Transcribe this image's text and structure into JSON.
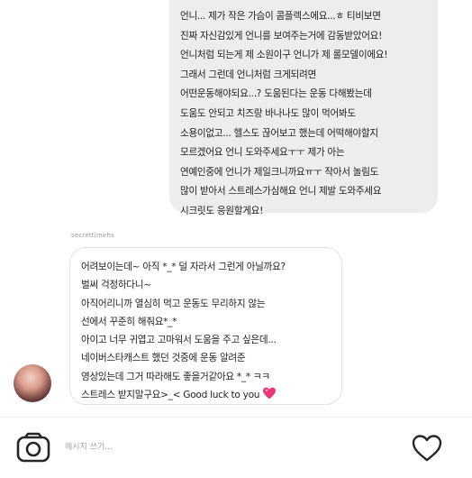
{
  "outgoing_message": {
    "lines": [
      "언니... 제가 작은 가슴이 콤플렉스에요...ㅎ 티비보면",
      "진짜 자신감있게 언니를 보여주는거에 감동받았어요!",
      "언니처럼 되는게 제 소원이구 언니가 제 롤모델이에요!",
      "그래서 그런데 언니처럼 크게되려면",
      "어떤운동해야되요...? 도움된다는 운동 다해봤는데",
      "도움도 안되고 치즈랑 바나나도 많이 먹어봐도",
      "소용이없고... 헬스도 끊어보고 했는데 어떡해야할지",
      "모르겠어요 언니 도와주세요ㅜㅜ 제가 아는",
      "연예인중에 언니가 제일크니까요ㅠㅜ 작아서 놀림도",
      "많이 받아서 스트레스가심해요 언니 제발 도와주세요",
      "시크릿도 응원할게요!"
    ]
  },
  "sender_name": "secrettimehs",
  "incoming_message": {
    "lines": [
      "어려보이는데~ 아직 *_* 덜 자라서 그런게 아닐까요?",
      "벌써 걱정하다니~",
      "아직어리니까 열심히 먹고 운동도 무리하지 않는",
      "선에서 꾸준히 해줘요*_*",
      "아이고 너무 귀엽고 고마워서 도움을 주고 싶은데...",
      "네이버스타캐스트 했던 것중에 운동 알려준",
      "영상있는데 그거 따라해도 좋을거같아요 *_* ㅋㅋ",
      "스트레스 받지말구요>_< Good luck to you"
    ],
    "heart_color": "#e8397a"
  },
  "input": {
    "placeholder": "메시지 쓰기..."
  },
  "icons": {
    "camera": "camera-icon",
    "heart": "heart-icon"
  }
}
